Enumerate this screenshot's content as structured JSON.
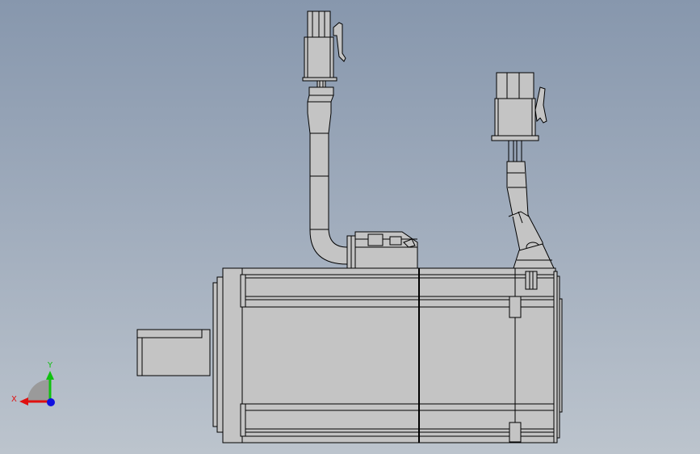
{
  "triad": {
    "x_label": "X",
    "y_label": "Y",
    "x_color": "#e01010",
    "y_color": "#10c010",
    "z_color": "#1010e0"
  },
  "colors": {
    "background_top": "#8797ad",
    "background_bottom": "#bcc4cd",
    "part_fill": "#c4c4c4",
    "part_edge": "#000000"
  }
}
